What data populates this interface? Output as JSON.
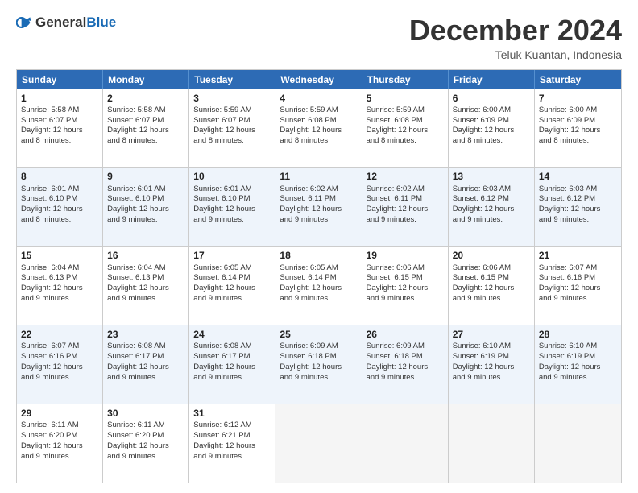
{
  "header": {
    "logo_general": "General",
    "logo_blue": "Blue",
    "month_title": "December 2024",
    "location": "Teluk Kuantan, Indonesia"
  },
  "weekdays": [
    "Sunday",
    "Monday",
    "Tuesday",
    "Wednesday",
    "Thursday",
    "Friday",
    "Saturday"
  ],
  "rows": [
    [
      {
        "day": "1",
        "lines": [
          "Sunrise: 5:58 AM",
          "Sunset: 6:07 PM",
          "Daylight: 12 hours",
          "and 8 minutes."
        ]
      },
      {
        "day": "2",
        "lines": [
          "Sunrise: 5:58 AM",
          "Sunset: 6:07 PM",
          "Daylight: 12 hours",
          "and 8 minutes."
        ]
      },
      {
        "day": "3",
        "lines": [
          "Sunrise: 5:59 AM",
          "Sunset: 6:07 PM",
          "Daylight: 12 hours",
          "and 8 minutes."
        ]
      },
      {
        "day": "4",
        "lines": [
          "Sunrise: 5:59 AM",
          "Sunset: 6:08 PM",
          "Daylight: 12 hours",
          "and 8 minutes."
        ]
      },
      {
        "day": "5",
        "lines": [
          "Sunrise: 5:59 AM",
          "Sunset: 6:08 PM",
          "Daylight: 12 hours",
          "and 8 minutes."
        ]
      },
      {
        "day": "6",
        "lines": [
          "Sunrise: 6:00 AM",
          "Sunset: 6:09 PM",
          "Daylight: 12 hours",
          "and 8 minutes."
        ]
      },
      {
        "day": "7",
        "lines": [
          "Sunrise: 6:00 AM",
          "Sunset: 6:09 PM",
          "Daylight: 12 hours",
          "and 8 minutes."
        ]
      }
    ],
    [
      {
        "day": "8",
        "lines": [
          "Sunrise: 6:01 AM",
          "Sunset: 6:10 PM",
          "Daylight: 12 hours",
          "and 8 minutes."
        ]
      },
      {
        "day": "9",
        "lines": [
          "Sunrise: 6:01 AM",
          "Sunset: 6:10 PM",
          "Daylight: 12 hours",
          "and 9 minutes."
        ]
      },
      {
        "day": "10",
        "lines": [
          "Sunrise: 6:01 AM",
          "Sunset: 6:10 PM",
          "Daylight: 12 hours",
          "and 9 minutes."
        ]
      },
      {
        "day": "11",
        "lines": [
          "Sunrise: 6:02 AM",
          "Sunset: 6:11 PM",
          "Daylight: 12 hours",
          "and 9 minutes."
        ]
      },
      {
        "day": "12",
        "lines": [
          "Sunrise: 6:02 AM",
          "Sunset: 6:11 PM",
          "Daylight: 12 hours",
          "and 9 minutes."
        ]
      },
      {
        "day": "13",
        "lines": [
          "Sunrise: 6:03 AM",
          "Sunset: 6:12 PM",
          "Daylight: 12 hours",
          "and 9 minutes."
        ]
      },
      {
        "day": "14",
        "lines": [
          "Sunrise: 6:03 AM",
          "Sunset: 6:12 PM",
          "Daylight: 12 hours",
          "and 9 minutes."
        ]
      }
    ],
    [
      {
        "day": "15",
        "lines": [
          "Sunrise: 6:04 AM",
          "Sunset: 6:13 PM",
          "Daylight: 12 hours",
          "and 9 minutes."
        ]
      },
      {
        "day": "16",
        "lines": [
          "Sunrise: 6:04 AM",
          "Sunset: 6:13 PM",
          "Daylight: 12 hours",
          "and 9 minutes."
        ]
      },
      {
        "day": "17",
        "lines": [
          "Sunrise: 6:05 AM",
          "Sunset: 6:14 PM",
          "Daylight: 12 hours",
          "and 9 minutes."
        ]
      },
      {
        "day": "18",
        "lines": [
          "Sunrise: 6:05 AM",
          "Sunset: 6:14 PM",
          "Daylight: 12 hours",
          "and 9 minutes."
        ]
      },
      {
        "day": "19",
        "lines": [
          "Sunrise: 6:06 AM",
          "Sunset: 6:15 PM",
          "Daylight: 12 hours",
          "and 9 minutes."
        ]
      },
      {
        "day": "20",
        "lines": [
          "Sunrise: 6:06 AM",
          "Sunset: 6:15 PM",
          "Daylight: 12 hours",
          "and 9 minutes."
        ]
      },
      {
        "day": "21",
        "lines": [
          "Sunrise: 6:07 AM",
          "Sunset: 6:16 PM",
          "Daylight: 12 hours",
          "and 9 minutes."
        ]
      }
    ],
    [
      {
        "day": "22",
        "lines": [
          "Sunrise: 6:07 AM",
          "Sunset: 6:16 PM",
          "Daylight: 12 hours",
          "and 9 minutes."
        ]
      },
      {
        "day": "23",
        "lines": [
          "Sunrise: 6:08 AM",
          "Sunset: 6:17 PM",
          "Daylight: 12 hours",
          "and 9 minutes."
        ]
      },
      {
        "day": "24",
        "lines": [
          "Sunrise: 6:08 AM",
          "Sunset: 6:17 PM",
          "Daylight: 12 hours",
          "and 9 minutes."
        ]
      },
      {
        "day": "25",
        "lines": [
          "Sunrise: 6:09 AM",
          "Sunset: 6:18 PM",
          "Daylight: 12 hours",
          "and 9 minutes."
        ]
      },
      {
        "day": "26",
        "lines": [
          "Sunrise: 6:09 AM",
          "Sunset: 6:18 PM",
          "Daylight: 12 hours",
          "and 9 minutes."
        ]
      },
      {
        "day": "27",
        "lines": [
          "Sunrise: 6:10 AM",
          "Sunset: 6:19 PM",
          "Daylight: 12 hours",
          "and 9 minutes."
        ]
      },
      {
        "day": "28",
        "lines": [
          "Sunrise: 6:10 AM",
          "Sunset: 6:19 PM",
          "Daylight: 12 hours",
          "and 9 minutes."
        ]
      }
    ],
    [
      {
        "day": "29",
        "lines": [
          "Sunrise: 6:11 AM",
          "Sunset: 6:20 PM",
          "Daylight: 12 hours",
          "and 9 minutes."
        ]
      },
      {
        "day": "30",
        "lines": [
          "Sunrise: 6:11 AM",
          "Sunset: 6:20 PM",
          "Daylight: 12 hours",
          "and 9 minutes."
        ]
      },
      {
        "day": "31",
        "lines": [
          "Sunrise: 6:12 AM",
          "Sunset: 6:21 PM",
          "Daylight: 12 hours",
          "and 9 minutes."
        ]
      },
      {
        "day": "",
        "lines": []
      },
      {
        "day": "",
        "lines": []
      },
      {
        "day": "",
        "lines": []
      },
      {
        "day": "",
        "lines": []
      }
    ]
  ]
}
